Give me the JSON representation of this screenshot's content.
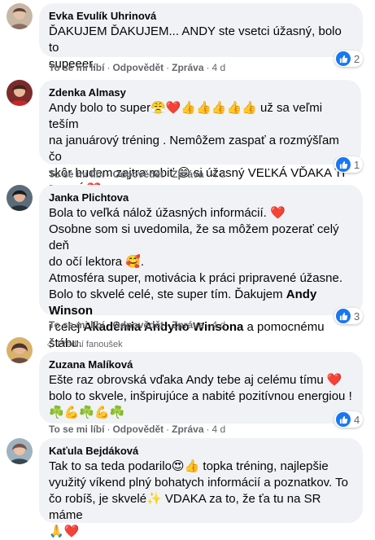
{
  "action_labels": {
    "like": "To se mi líbí",
    "reply": "Odpovědět",
    "share": "Zpráva",
    "separator": "·"
  },
  "comments": [
    {
      "name": "Evka Evulík Uhrinová",
      "lines": [
        "ĎAKUJEM ĎAKUJEM... ANDY ste vsetci úžasný, bolo to",
        "supeeer."
      ],
      "time": "4 d",
      "likes": "2"
    },
    {
      "name": "Zdenka Almasy",
      "lines": [
        "Andy bolo to super😤❤️👍👍👍👍👍 už sa veľmi teším",
        "na januárový tréning . Nemôžem zaspať a rozmýšľam čo",
        "skôr budem zajtra robiť 😄 si úžasný VEĽKÁ VĎAKA TI",
        "PATRÍ ❤️"
      ],
      "time": "4 d",
      "likes": "1"
    },
    {
      "name": "Janka Plichtova",
      "line1": "Bola to veľká nálož úžasných informácií. ❤️",
      "line2": "Osobne som si uvedomila, že sa môžem pozerať celý deň",
      "line3": "do očí lektora 🥰.",
      "line4": "Atmosféra super, motivácia k práci pripravené úžasne.",
      "line5_pre": "Bolo to skvelé celé, ste super tím. Ďakujem ",
      "line5_bold": "Andy Winson",
      "line6_pre": "i celej ",
      "line6_bold": "Akadémia Andyho Winsona",
      "line6_post": " a pomocnému štábu.",
      "line7": "👍💯👌",
      "time": "4 d",
      "likes": "3"
    },
    {
      "fan_label": "Přední fanoušek",
      "name": "Zuzana Malíková",
      "lines": [
        "Ešte raz obrovská vďaka Andy tebe aj celému tímu ❤️",
        "bolo to skvele, inšpirujúce a nabité pozitívnou energiou !",
        "☘️💪☘️💪☘️"
      ],
      "time": "4 d",
      "likes": "4"
    },
    {
      "name": "Kaťula Bejdáková",
      "lines": [
        "Tak to sa teda podarilo😍👍 topka tréning, najlepšie",
        "využitý víkend plný bohatych informácií a poznatkov. To",
        "čo robíš, je skvelé✨ VDAKA za to, že ťa tu na SR máme",
        "🙏❤️"
      ]
    }
  ]
}
